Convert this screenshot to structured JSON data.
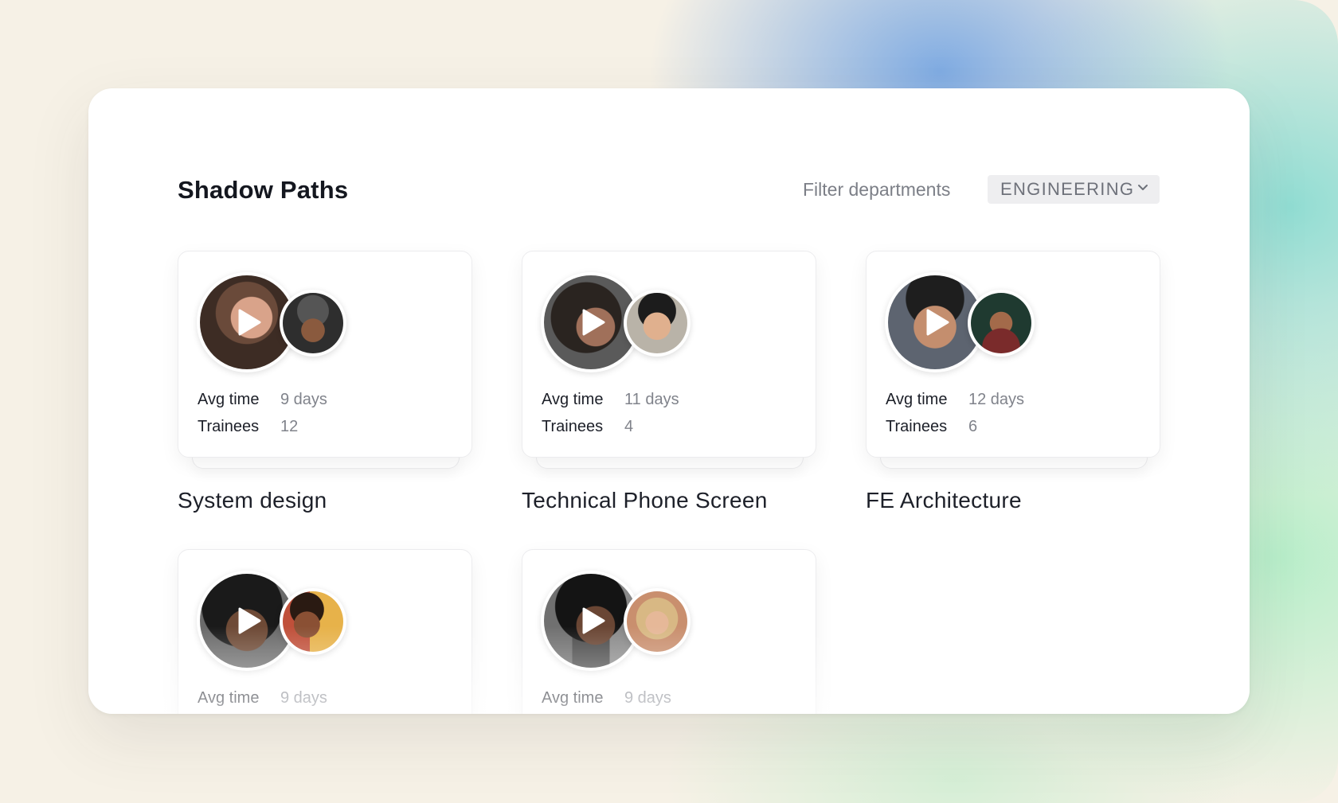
{
  "header": {
    "title": "Shadow Paths",
    "filter_label": "Filter departments",
    "filter_value": "ENGINEERING"
  },
  "paths": [
    {
      "title": "System design",
      "avg_time_label": "Avg time",
      "avg_time": "9 days",
      "trainees_label": "Trainees",
      "trainees": "12"
    },
    {
      "title": "Technical Phone Screen",
      "avg_time_label": "Avg time",
      "avg_time": "11 days",
      "trainees_label": "Trainees",
      "trainees": "4"
    },
    {
      "title": "FE Architecture",
      "avg_time_label": "Avg time",
      "avg_time": "12 days",
      "trainees_label": "Trainees",
      "trainees": "6"
    },
    {
      "title": "",
      "avg_time_label": "Avg time",
      "avg_time": "9 days"
    },
    {
      "title": "",
      "avg_time_label": "Avg time",
      "avg_time": "9 days"
    }
  ],
  "icons": {
    "play": "play-icon",
    "dropdown": "chevron-down-icon"
  },
  "colors": {
    "accent_blue": "#7aa8e2",
    "accent_teal": "#8cdcd2",
    "accent_green": "#b4eec8",
    "text_dark": "#14171f",
    "text_muted": "#80838b"
  }
}
